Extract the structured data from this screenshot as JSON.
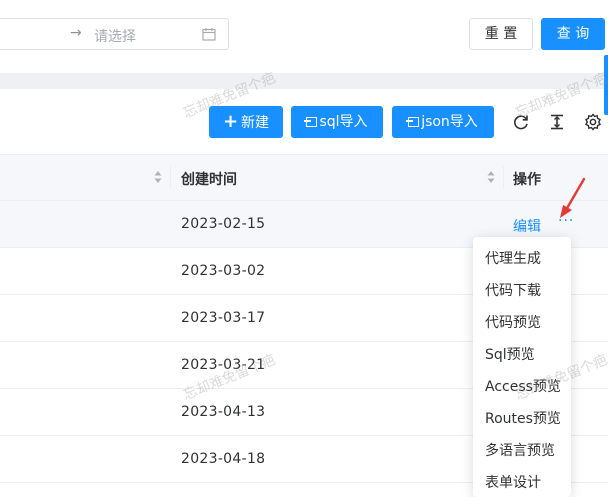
{
  "filter": {
    "date_range_separator": "→",
    "date_range_placeholder": "请选择",
    "reset_label": "重 置",
    "query_label": "查 询"
  },
  "toolbar": {
    "new_icon": "+",
    "new_label": "新建",
    "sql_import_label": "sql导入",
    "json_import_label": "json导入",
    "icons": [
      "refresh-icon",
      "column-height-icon",
      "settings-icon"
    ]
  },
  "table": {
    "header_created_time": "创建时间",
    "header_actions": "操作",
    "rows": [
      {
        "created": "2023-02-15"
      },
      {
        "created": "2023-03-02"
      },
      {
        "created": "2023-03-17"
      },
      {
        "created": "2023-03-21"
      },
      {
        "created": "2023-04-13"
      },
      {
        "created": "2023-04-18"
      }
    ],
    "edit_label": "编辑",
    "more_label": "···"
  },
  "dropdown": {
    "items": [
      "代理生成",
      "代码下载",
      "代码预览",
      "Sql预览",
      "Access预览",
      "Routes预览",
      "多语言预览",
      "表单设计"
    ]
  },
  "watermark": {
    "text": "忘却难免留个疤"
  },
  "colors": {
    "primary": "#1890ff",
    "annotation_arrow": "#e53935"
  }
}
